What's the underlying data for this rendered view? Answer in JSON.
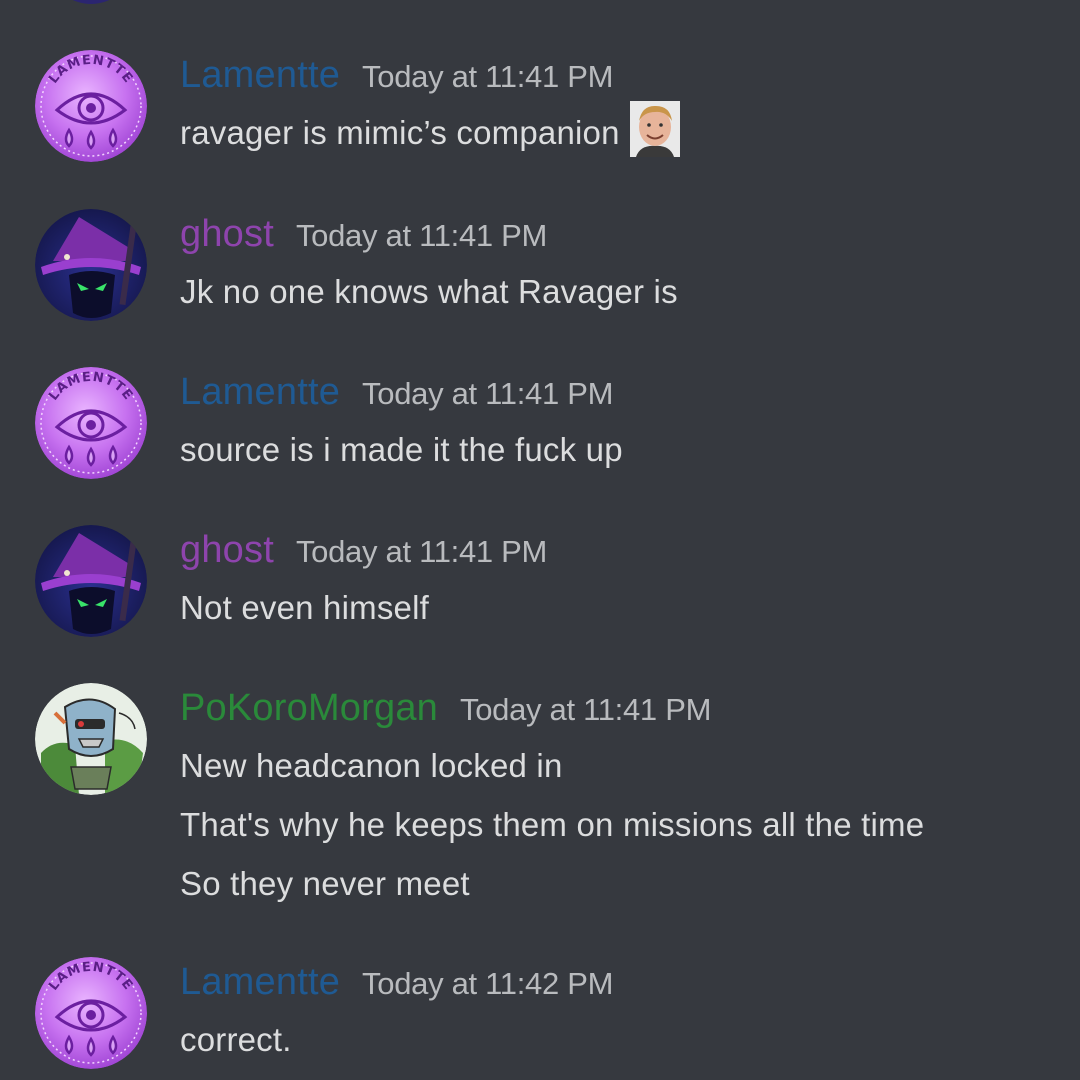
{
  "colors": {
    "background": "#36393f",
    "message_text": "#dcddde",
    "timestamp": "#b9bbbe",
    "lamentte_name": "#1f5a93",
    "ghost_name": "#8e44ad",
    "pokoro_name": "#2a8a3a"
  },
  "messages": [
    {
      "author": "Lamentte",
      "timestamp": "Today at 11:41 PM",
      "avatar_icon": "lamentte-eye-avatar-icon",
      "avatar_text": "LAMENTTE",
      "lines": [
        "ravager is mimic’s companion"
      ],
      "emoji": "smiling-man-face-emoji-icon"
    },
    {
      "author": "ghost",
      "timestamp": "Today at 11:41 PM",
      "avatar_icon": "ghost-witch-avatar-icon",
      "lines": [
        "Jk no one knows what Ravager is"
      ]
    },
    {
      "author": "Lamentte",
      "timestamp": "Today at 11:41 PM",
      "avatar_icon": "lamentte-eye-avatar-icon",
      "avatar_text": "LAMENTTE",
      "lines": [
        "source is i made it the fuck up"
      ]
    },
    {
      "author": "ghost",
      "timestamp": "Today at 11:41 PM",
      "avatar_icon": "ghost-witch-avatar-icon",
      "lines": [
        "Not even himself"
      ]
    },
    {
      "author": "PoKoroMorgan",
      "timestamp": "Today at 11:41 PM",
      "avatar_icon": "robot-drawing-avatar-icon",
      "lines": [
        "New headcanon locked in",
        "That's why he keeps them on missions all the time",
        "So they never meet"
      ]
    },
    {
      "author": "Lamentte",
      "timestamp": "Today at 11:42 PM",
      "avatar_icon": "lamentte-eye-avatar-icon",
      "avatar_text": "LAMENTTE",
      "lines": [
        "correct."
      ]
    }
  ]
}
